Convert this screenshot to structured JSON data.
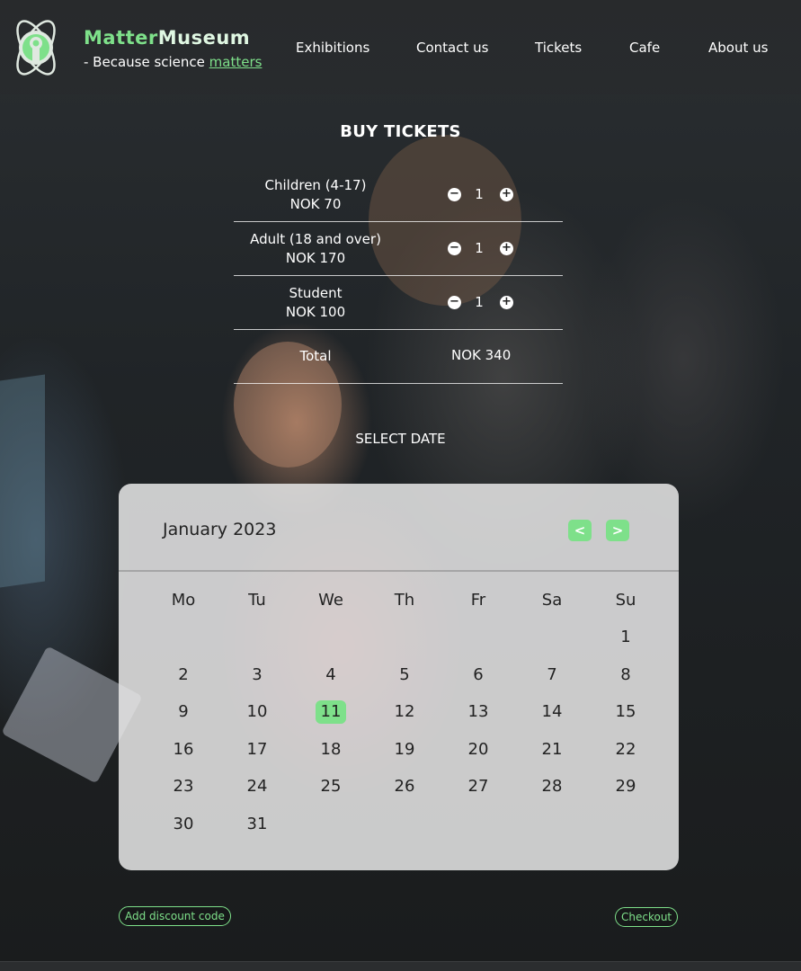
{
  "header": {
    "brand_part1": "Matter",
    "brand_part2": "Museum",
    "tagline_prefix": "- Because science ",
    "tagline_highlight": "matters",
    "nav": [
      "Exhibitions",
      "Contact us",
      "Tickets",
      "Cafe",
      "About us"
    ]
  },
  "tickets": {
    "title": "BUY TICKETS",
    "rows": [
      {
        "name": "Children (4-17)",
        "price": "NOK 70",
        "qty": "1"
      },
      {
        "name": "Adult (18 and over)",
        "price": "NOK 170",
        "qty": "1"
      },
      {
        "name": "Student",
        "price": "NOK 100",
        "qty": "1"
      }
    ],
    "total_label": "Total",
    "total_value": "NOK 340",
    "minus_symbol": "−",
    "plus_symbol": "+"
  },
  "date": {
    "label": "SELECT DATE",
    "month": "January 2023",
    "prev": "<",
    "next": ">",
    "weekdays": [
      "Mo",
      "Tu",
      "We",
      "Th",
      "Fr",
      "Sa",
      "Su"
    ],
    "selected_day": "11",
    "days": [
      "1",
      "2",
      "3",
      "4",
      "5",
      "6",
      "7",
      "8",
      "9",
      "10",
      "11",
      "12",
      "13",
      "14",
      "15",
      "16",
      "17",
      "18",
      "19",
      "20",
      "21",
      "22",
      "23",
      "24",
      "25",
      "26",
      "27",
      "28",
      "29",
      "30",
      "31"
    ]
  },
  "actions": {
    "discount": "Add discount code",
    "checkout": "Checkout"
  },
  "colors": {
    "accent": "#7ee08a",
    "calendar_bg": "#e8e8e8"
  }
}
